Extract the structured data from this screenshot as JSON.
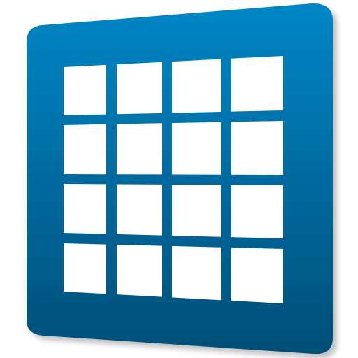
{
  "icon": {
    "name": "grid-app-icon",
    "colors": {
      "gradient_top": "#0686c6",
      "gradient_bottom": "#064f78",
      "tile": "#ffffff",
      "shadow": "#00000033"
    },
    "grid": {
      "rows": 4,
      "columns": 4
    }
  }
}
